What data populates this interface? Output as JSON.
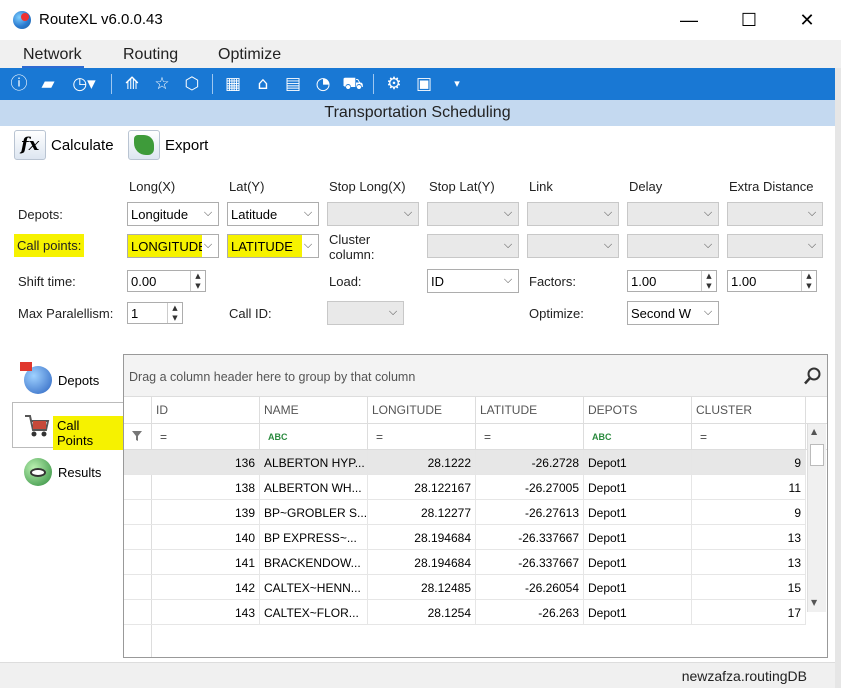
{
  "window": {
    "title": "RouteXL v6.0.0.43",
    "min_glyph": "—",
    "max_glyph": "☐",
    "close_glyph": "✕"
  },
  "menu": {
    "items": [
      "Network",
      "Routing",
      "Optimize"
    ],
    "active": "Network"
  },
  "toolbar": {
    "icons": [
      "info-icon",
      "folder-open-icon",
      "dashboard-dropdown-icon",
      "road-icon",
      "star-icon",
      "polygon-icon",
      "grid-icon",
      "warehouses-icon",
      "document-icon",
      "clock-truck-icon",
      "trucks-icon",
      "settings-icon",
      "save-icon",
      "more-dropdown-icon"
    ]
  },
  "section": {
    "title": "Transportation Scheduling"
  },
  "actions": {
    "calculate": "Calculate",
    "export": "Export",
    "calc_icon_text": "fx"
  },
  "form": {
    "columns": [
      "Long(X)",
      "Lat(Y)",
      "Stop Long(X)",
      "Stop Lat(Y)",
      "Link",
      "Delay",
      "Extra Distance"
    ],
    "depots_label": "Depots:",
    "depots_long": "Longitude",
    "depots_lat": "Latitude",
    "call_points_label": "Call points:",
    "call_long": "LONGITUDE",
    "call_lat": "LATITUDE",
    "cluster_label": "Cluster column:",
    "shift_label": "Shift time:",
    "shift_value": "0.00",
    "load_label": "Load:",
    "load_value": "ID",
    "factors_label": "Factors:",
    "factor1": "1.00",
    "factor2": "1.00",
    "maxpar_label": "Max Paralellism:",
    "maxpar_value": "1",
    "callid_label": "Call ID:",
    "optimize_label": "Optimize:",
    "optimize_value": "Second W"
  },
  "side_tabs": [
    "Depots",
    "Call Points",
    "Results"
  ],
  "grid": {
    "group_hint": "Drag a column header here to group by that column",
    "columns": [
      "ID",
      "NAME",
      "LONGITUDE",
      "LATITUDE",
      "DEPOTS",
      "CLUSTER"
    ],
    "filter_text_marker": "ABC",
    "filter_num_marker": "=",
    "rows": [
      [
        "136",
        "ALBERTON HYP...",
        "28.1222",
        "-26.2728",
        "Depot1",
        "9"
      ],
      [
        "138",
        "ALBERTON WH...",
        "28.122167",
        "-26.27005",
        "Depot1",
        "11"
      ],
      [
        "139",
        "BP~GROBLER S...",
        "28.12277",
        "-26.27613",
        "Depot1",
        "9"
      ],
      [
        "140",
        "BP EXPRESS~...",
        "28.194684",
        "-26.337667",
        "Depot1",
        "13"
      ],
      [
        "141",
        "BRACKENDOW...",
        "28.194684",
        "-26.337667",
        "Depot1",
        "13"
      ],
      [
        "142",
        "CALTEX~HENN...",
        "28.12485",
        "-26.26054",
        "Depot1",
        "15"
      ],
      [
        "143",
        "CALTEX~FLOR...",
        "28.1254",
        "-26.263",
        "Depot1",
        "17"
      ]
    ]
  },
  "status": {
    "db": "newzafza.routingDB"
  },
  "colors": {
    "toolbar": "#1978d4",
    "header_band": "#c4d9f0",
    "highlight": "#f6f200"
  }
}
